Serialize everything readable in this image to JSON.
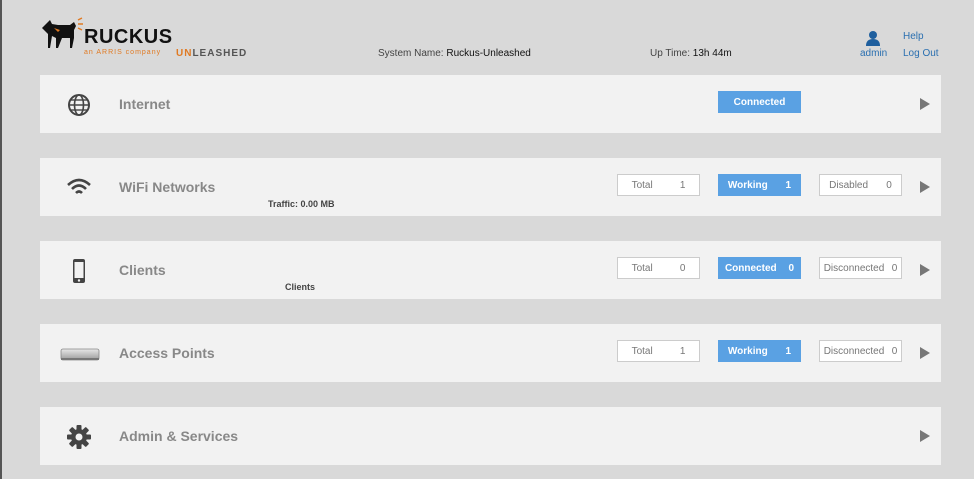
{
  "header": {
    "logo_text": "RUCKUS",
    "logo_sub": "an ARRIS company",
    "unleashed_prefix": "UN",
    "unleashed_suffix": "LEASHED",
    "system_name_label": "System Name:",
    "system_name_value": "Ruckus-Unleashed",
    "uptime_label": "Up Time:",
    "uptime_value": "13h 44m",
    "user": "admin",
    "help": "Help",
    "logout": "Log Out"
  },
  "colors": {
    "accent": "#5aa1e3",
    "brand_orange": "#e07a23",
    "link": "#2a6fb0"
  },
  "panels": {
    "internet": {
      "title": "Internet",
      "status": "Connected"
    },
    "wifi": {
      "title": "WiFi Networks",
      "sub": "Traffic: 0.00 MB",
      "total_label": "Total",
      "total_value": "1",
      "working_label": "Working",
      "working_value": "1",
      "disabled_label": "Disabled",
      "disabled_value": "0"
    },
    "clients": {
      "title": "Clients",
      "sub": "Clients",
      "total_label": "Total",
      "total_value": "0",
      "connected_label": "Connected",
      "connected_value": "0",
      "disconnected_label": "Disconnected",
      "disconnected_value": "0"
    },
    "aps": {
      "title": "Access Points",
      "total_label": "Total",
      "total_value": "1",
      "working_label": "Working",
      "working_value": "1",
      "disconnected_label": "Disconnected",
      "disconnected_value": "0"
    },
    "admin": {
      "title": "Admin & Services"
    }
  },
  "icons": {
    "internet": "globe-icon",
    "wifi": "wifi-icon",
    "clients": "phone-icon",
    "aps": "access-point-icon",
    "admin": "gear-icon",
    "user": "user-icon",
    "expand": "expand-arrow-icon"
  }
}
